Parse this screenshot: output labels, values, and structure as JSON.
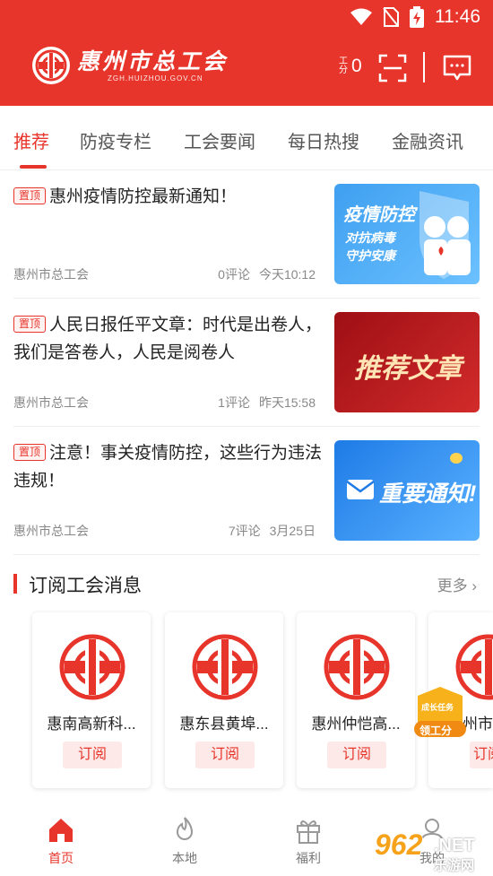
{
  "status_bar": {
    "time": "11:46"
  },
  "header": {
    "logo_title": "惠州市总工会",
    "logo_sub": "ZGH.HUIZHOU.GOV.CN",
    "points_label": "工分",
    "points_value": "0",
    "brand_color": "#e8352b"
  },
  "tabs": [
    {
      "label": "推荐"
    },
    {
      "label": "防疫专栏"
    },
    {
      "label": "工会要闻"
    },
    {
      "label": "每日热搜"
    },
    {
      "label": "金融资讯"
    }
  ],
  "news": [
    {
      "badge": "置顶",
      "title": "惠州疫情防控最新通知！",
      "source": "惠州市总工会",
      "comments": "0评论",
      "time": "今天10:12",
      "thumb_lines": [
        "疫情防控",
        "对抗病毒",
        "守护安康"
      ]
    },
    {
      "badge": "置顶",
      "title": "人民日报任平文章：时代是出卷人，我们是答卷人，人民是阅卷人",
      "source": "惠州市总工会",
      "comments": "1评论",
      "time": "昨天15:58",
      "thumb_lines": [
        "推荐文章"
      ]
    },
    {
      "badge": "置顶",
      "title": "注意！事关疫情防控，这些行为违法违规！",
      "source": "惠州市总工会",
      "comments": "7评论",
      "time": "3月25日",
      "thumb_lines": [
        "重要通知!"
      ]
    }
  ],
  "subscribe": {
    "title": "订阅工会消息",
    "more": "更多",
    "cards": [
      {
        "name": "惠南高新科...",
        "button": "订阅"
      },
      {
        "name": "惠东县黄埠...",
        "button": "订阅"
      },
      {
        "name": "惠州仲恺高...",
        "button": "订阅"
      },
      {
        "name": "州市",
        "button": "订阅"
      }
    ]
  },
  "float_task": {
    "line1": "成长任务",
    "line2": "领工分"
  },
  "bottom_nav": [
    {
      "label": "首页",
      "icon": "home-icon"
    },
    {
      "label": "本地",
      "icon": "flame-icon"
    },
    {
      "label": "福利",
      "icon": "gift-icon"
    },
    {
      "label": "我的",
      "icon": "user-icon"
    }
  ],
  "watermark": {
    "number": "962",
    "suffix": ".NET",
    "site": "乐游网"
  }
}
